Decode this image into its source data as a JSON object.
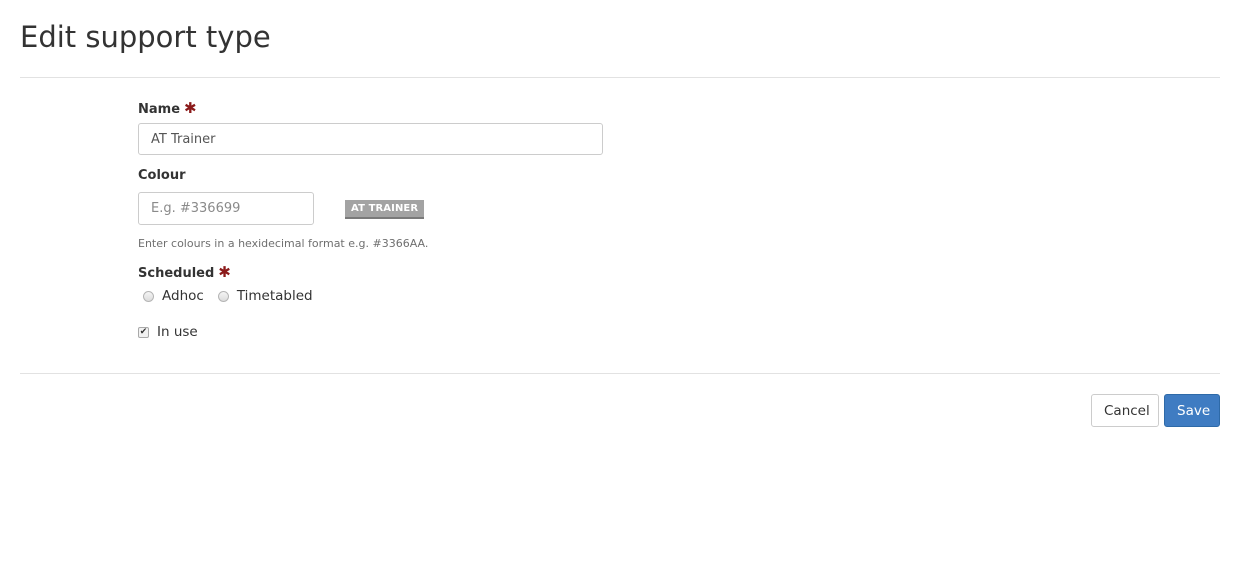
{
  "page": {
    "title": "Edit support type"
  },
  "form": {
    "name": {
      "label": "Name",
      "required_marker": "✱",
      "value": "AT Trainer"
    },
    "colour": {
      "label": "Colour",
      "value": "",
      "placeholder": "E.g. #336699",
      "preview_label": "AT TRAINER",
      "preview_color": "#a3a3a3",
      "help_text": "Enter colours in a hexidecimal format e.g. #3366AA."
    },
    "scheduled": {
      "label": "Scheduled",
      "required_marker": "✱",
      "options": [
        {
          "label": "Adhoc",
          "selected": false
        },
        {
          "label": "Timetabled",
          "selected": false
        }
      ]
    },
    "in_use": {
      "label": "In use",
      "checked": true,
      "check_glyph": "✔"
    }
  },
  "actions": {
    "cancel_label": "Cancel",
    "save_label": "Save",
    "save_color": "#3f7cc2"
  }
}
